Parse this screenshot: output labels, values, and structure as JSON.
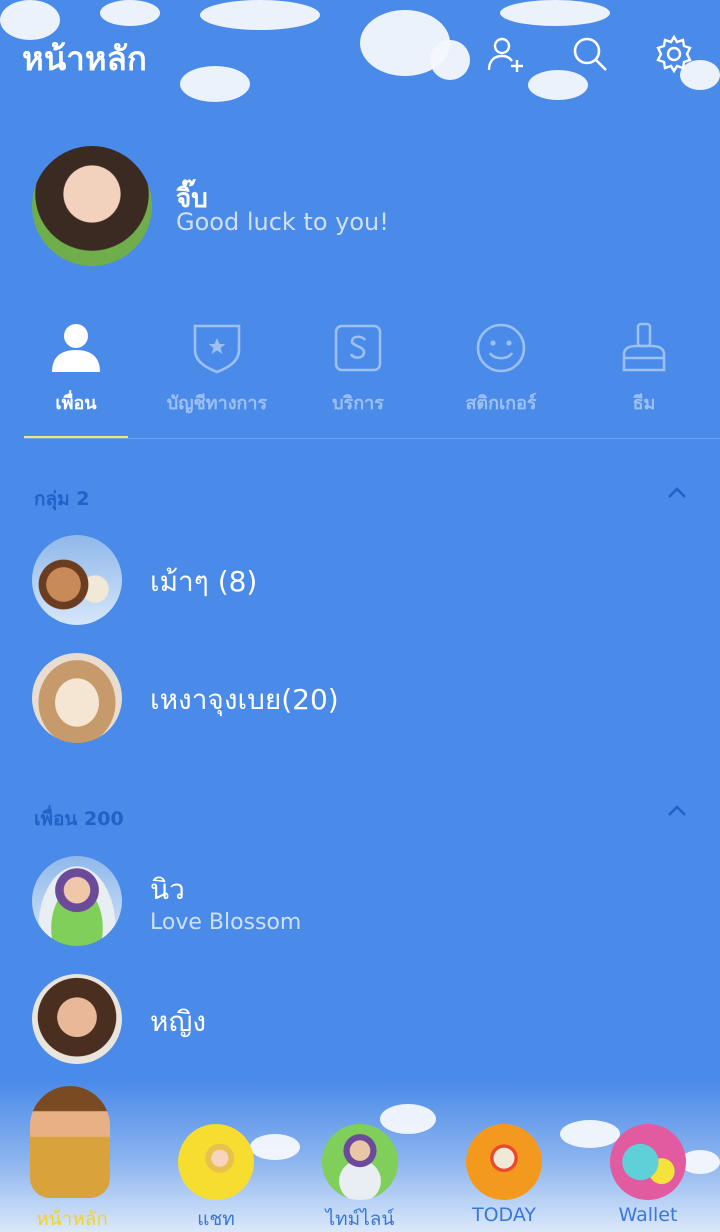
{
  "header": {
    "title": "หน้าหลัก",
    "icons": [
      "add-friend-icon",
      "search-icon",
      "gear-icon"
    ]
  },
  "profile": {
    "name": "จิ๊บ",
    "status": "Good luck to you!"
  },
  "tabs": [
    {
      "label": "เพื่อน",
      "icon": "person-icon",
      "active": true
    },
    {
      "label": "บัญชีทางการ",
      "icon": "shield-star-icon",
      "active": false
    },
    {
      "label": "บริการ",
      "icon": "service-s-icon",
      "active": false
    },
    {
      "label": "สติกเกอร์",
      "icon": "smiley-icon",
      "active": false
    },
    {
      "label": "ธีม",
      "icon": "brush-icon",
      "active": false
    }
  ],
  "groups": {
    "header": "กลุ่ม 2",
    "items": [
      {
        "name": "เม้าๆ (8)"
      },
      {
        "name": "เหงาจุงเบย(20)"
      }
    ]
  },
  "friends": {
    "header": "เพื่อน 200",
    "items": [
      {
        "name": "นิว",
        "status": "Love Blossom"
      },
      {
        "name": "หญิง"
      }
    ]
  },
  "bottom_nav": [
    {
      "label": "หน้าหลัก",
      "active": true
    },
    {
      "label": "แชท",
      "active": false
    },
    {
      "label": "ไทม์ไลน์",
      "active": false
    },
    {
      "label": "TODAY",
      "active": false
    },
    {
      "label": "Wallet",
      "active": false
    }
  ],
  "colors": {
    "background": "#4a8ae8",
    "section_header": "#1f63c8",
    "active_underline": "#f5e27a",
    "active_nav_label": "#f3d22b"
  }
}
